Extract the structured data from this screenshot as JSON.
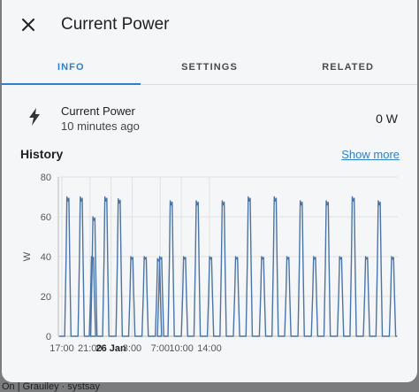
{
  "dialog": {
    "title": "Current Power",
    "close_icon": "close-icon"
  },
  "tabs": [
    {
      "label": "INFO",
      "active": true
    },
    {
      "label": "SETTINGS",
      "active": false
    },
    {
      "label": "RELATED",
      "active": false
    }
  ],
  "entity": {
    "icon": "lightning-bolt-icon",
    "name": "Current Power",
    "last_changed": "10 minutes ago",
    "state": "0 W"
  },
  "history": {
    "title": "History",
    "show_more": "Show more"
  },
  "backdrop": {
    "text": "On | Grauiley · systsay"
  },
  "colors": {
    "accent": "#2f80c8",
    "series": "#4b74a6"
  },
  "chart_data": {
    "type": "line",
    "ylabel": "W",
    "ylim": [
      0,
      80
    ],
    "yticks": [
      0,
      20,
      40,
      60,
      80
    ],
    "xlim_hours": [
      16.5,
      64.8
    ],
    "xticks": [
      {
        "hour": 17,
        "label": "17:00",
        "bold": false
      },
      {
        "hour": 21,
        "label": "21:00",
        "bold": false
      },
      {
        "hour": 24,
        "label": "26 Jan",
        "bold": true
      },
      {
        "hour": 27,
        "label": "3:00",
        "bold": false
      },
      {
        "hour": 31,
        "label": "7:00",
        "bold": false
      },
      {
        "hour": 34,
        "label": "10:00",
        "bold": false
      },
      {
        "hour": 38,
        "label": "14:00",
        "bold": false
      }
    ],
    "series": [
      {
        "name": "",
        "pulses": [
          {
            "start": 17.4,
            "peak": 70
          },
          {
            "start": 19.3,
            "peak": 70
          },
          {
            "start": 20.9,
            "peak": 40
          },
          {
            "start": 21.1,
            "peak": 60
          },
          {
            "start": 22.8,
            "peak": 70
          },
          {
            "start": 24.7,
            "peak": 69
          },
          {
            "start": 26.5,
            "peak": 40
          },
          {
            "start": 28.4,
            "peak": 40
          },
          {
            "start": 30.3,
            "peak": 39
          },
          {
            "start": 30.6,
            "peak": 40
          },
          {
            "start": 32.1,
            "peak": 68
          },
          {
            "start": 34.0,
            "peak": 40
          },
          {
            "start": 35.8,
            "peak": 68
          },
          {
            "start": 37.7,
            "peak": 40
          },
          {
            "start": 39.5,
            "peak": 68
          },
          {
            "start": 41.4,
            "peak": 40
          },
          {
            "start": 43.2,
            "peak": 70
          },
          {
            "start": 45.1,
            "peak": 40
          },
          {
            "start": 46.9,
            "peak": 70
          },
          {
            "start": 48.7,
            "peak": 40
          },
          {
            "start": 50.6,
            "peak": 68
          },
          {
            "start": 52.5,
            "peak": 40
          },
          {
            "start": 54.3,
            "peak": 68
          },
          {
            "start": 56.2,
            "peak": 40
          },
          {
            "start": 58.0,
            "peak": 70
          },
          {
            "start": 59.9,
            "peak": 40
          },
          {
            "start": 61.7,
            "peak": 68
          },
          {
            "start": 63.6,
            "peak": 40
          }
        ]
      }
    ]
  }
}
